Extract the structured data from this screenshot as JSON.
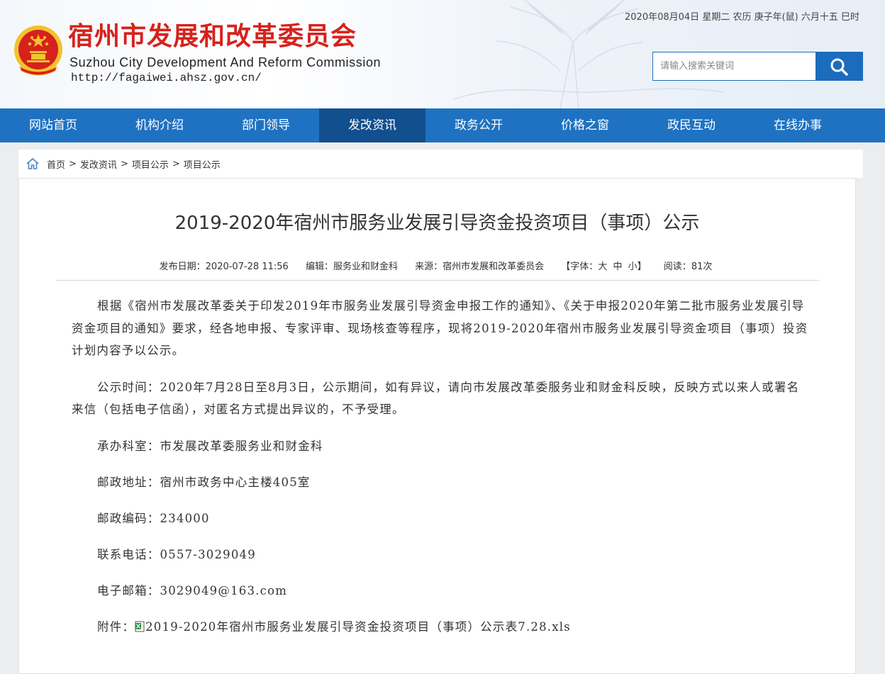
{
  "header": {
    "title": "宿州市发展和改革委员会",
    "subtitle_en": "Suzhou City Development And Reform Commission",
    "url": "http://fagaiwei.ahsz.gov.cn/",
    "date": "2020年08月04日 星期二 农历 庚子年(鼠) 六月十五 巳时",
    "search_placeholder": "请输入搜索关键词",
    "emblem_icon": "national-emblem-icon",
    "brand_color": "#d6221c",
    "accent_color": "#1f72c1"
  },
  "nav": {
    "items": [
      "网站首页",
      "机构介绍",
      "部门领导",
      "发改资讯",
      "政务公开",
      "价格之窗",
      "政民互动",
      "在线办事"
    ],
    "active_index": 3
  },
  "breadcrumb": {
    "items": [
      "首页",
      "发改资讯",
      "项目公示",
      "项目公示"
    ],
    "separator": ">"
  },
  "article": {
    "title": "2019-2020年宿州市服务业发展引导资金投资项目（事项）公示",
    "meta": {
      "date_label": "发布日期：",
      "date": "2020-07-28 11:56",
      "editor_label": "编辑：",
      "editor": "服务业和财金科",
      "source_label": "来源：",
      "source": "宿州市发展和改革委员会",
      "font_label_open": "【字体：",
      "font_large": "大",
      "font_medium": "中",
      "font_small": "小",
      "font_label_close": "】",
      "reads_label": "阅读：",
      "reads": "81次"
    },
    "paragraphs": [
      "根据《宿州市发展改革委关于印发2019年市服务业发展引导资金申报工作的通知》、《关于申报2020年第二批市服务业发展引导资金项目的通知》要求，经各地申报、专家评审、现场核查等程序，现将2019-2020年宿州市服务业发展引导资金项目（事项）投资计划内容予以公示。",
      "公示时间：2020年7月28日至8月3日，公示期间，如有异议，请向市发展改革委服务业和财金科反映，反映方式以来人或署名来信（包括电子信函），对匿名方式提出异议的，不予受理。"
    ],
    "lines": [
      "承办科室：市发展改革委服务业和财金科",
      "邮政地址：宿州市政务中心主楼405室",
      "邮政编码：234000",
      "联系电话：0557-3029049",
      "电子邮箱：3029049@163.com"
    ],
    "attachment_label": "附件：",
    "attachment_file": "2019-2020年宿州市服务业发展引导资金投资项目（事项）公示表7.28.xls",
    "attachment_icon": "excel-file-icon"
  }
}
